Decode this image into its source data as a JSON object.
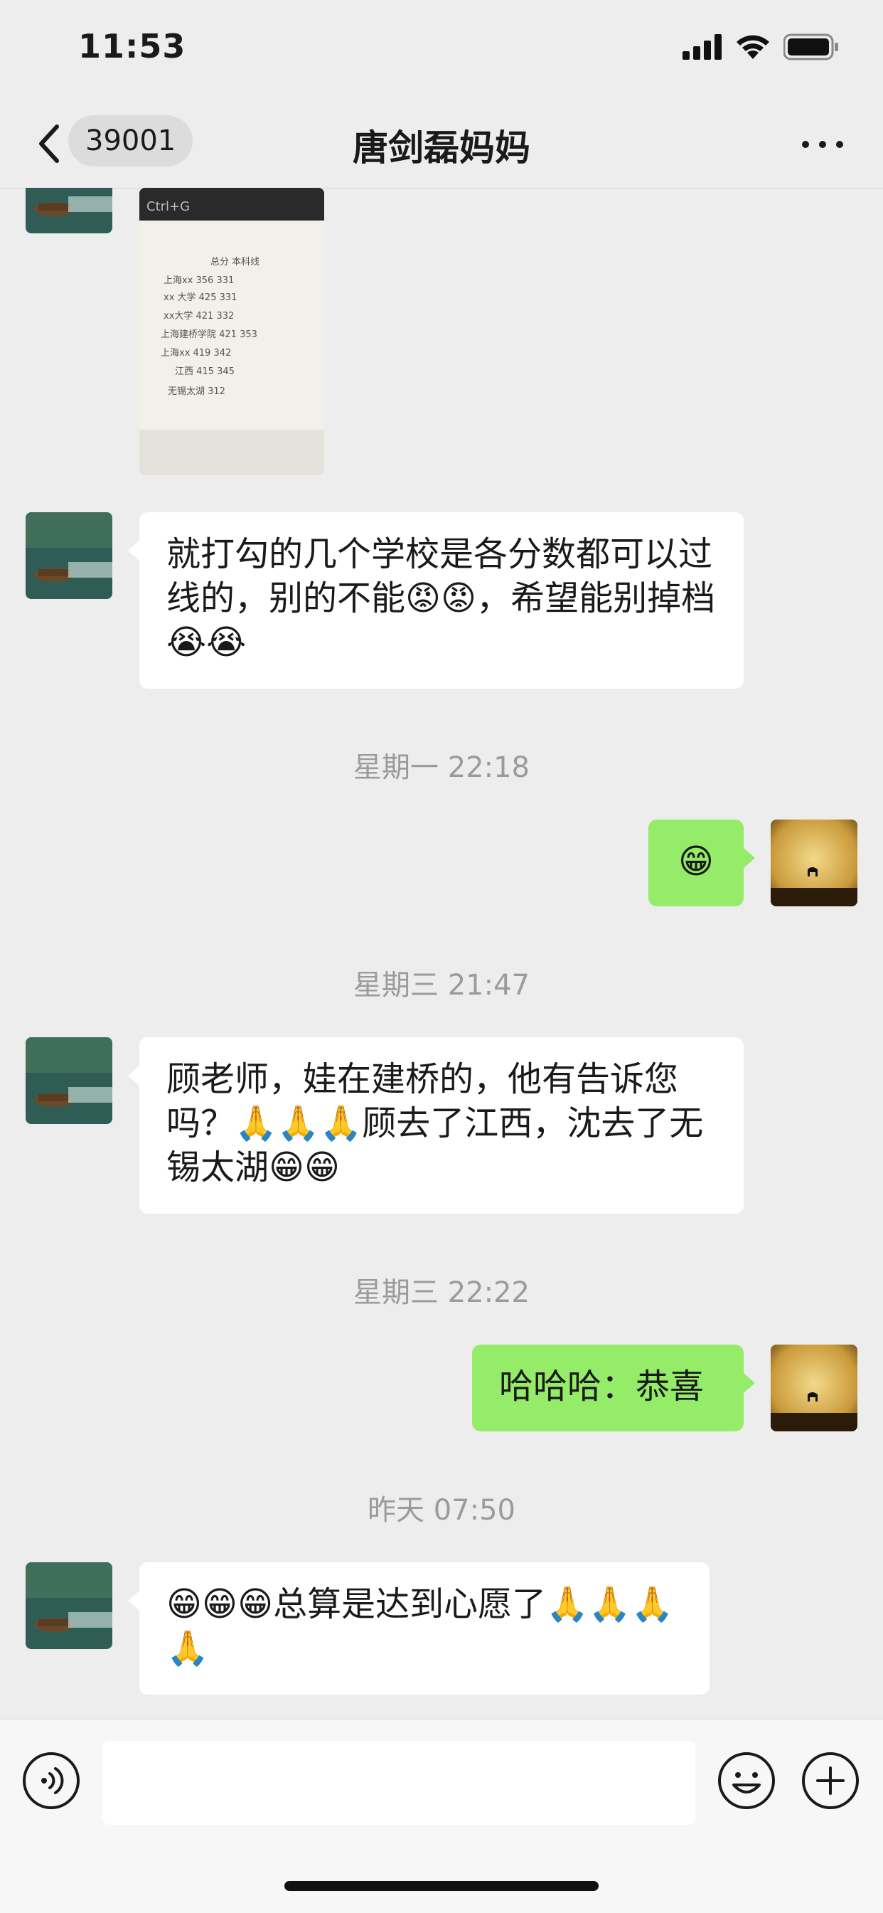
{
  "status_bar": {
    "time": "11:53"
  },
  "nav": {
    "unread_badge": "39001",
    "title": "唐剑磊妈妈"
  },
  "messages": [
    {
      "side": "left",
      "type": "image"
    },
    {
      "side": "left",
      "text": "就打勾的几个学校是各分数都可以过线的，别的不能😡😡，希望能别掉档😭😭"
    },
    {
      "type": "timestamp",
      "text": "星期一 22:18"
    },
    {
      "side": "right",
      "text": "😁"
    },
    {
      "type": "timestamp",
      "text": "星期三 21:47"
    },
    {
      "side": "left",
      "text": "顾老师，娃在建桥的，他有告诉您吗？🙏🙏🙏顾去了江西，沈去了无锡太湖😁😁"
    },
    {
      "type": "timestamp",
      "text": "星期三 22:22"
    },
    {
      "side": "right",
      "text": "哈哈哈：恭喜"
    },
    {
      "type": "timestamp",
      "text": "昨天 07:50"
    },
    {
      "side": "left",
      "text": "😁😁😁总算是达到心愿了🙏🙏🙏🙏"
    }
  ],
  "photo_note": {
    "lines": [
      "总分 本科线",
      "上海xx 356 331",
      "xx 大学 425 331",
      "xx大学 421 332",
      "上海建桥学院 421 353",
      "上海xx 419 342",
      "江西 415 345",
      "无锡太湖 312"
    ]
  },
  "colors": {
    "background": "#ededed",
    "bubble_self": "#95ec69",
    "bubble_other": "#ffffff"
  }
}
